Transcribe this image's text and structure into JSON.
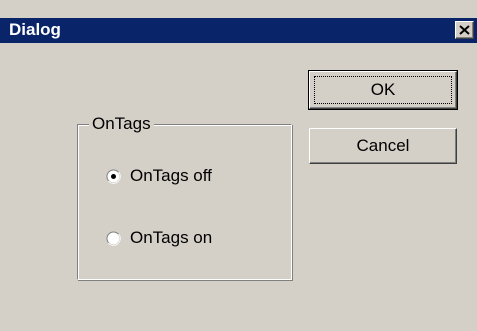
{
  "window": {
    "title": "Dialog"
  },
  "buttons": {
    "ok_label": "OK",
    "cancel_label": "Cancel"
  },
  "group": {
    "label": "OnTags",
    "options": [
      {
        "label": "OnTags off",
        "selected": true
      },
      {
        "label": "OnTags on",
        "selected": false
      }
    ]
  },
  "icons": {
    "close": "close-icon"
  },
  "colors": {
    "titlebar": "#0a246a",
    "face": "#d4d0c8",
    "title_text": "#ffffff"
  }
}
